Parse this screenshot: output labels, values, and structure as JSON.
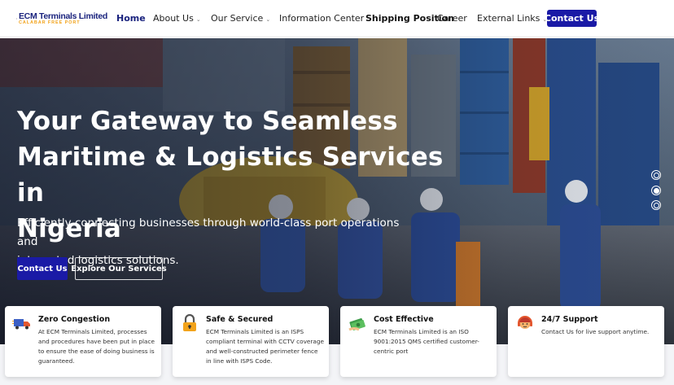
{
  "brand": {
    "name": "ECM Terminals Limited",
    "tagline": "CALABAR FREE PORT"
  },
  "nav": {
    "items": [
      {
        "label": "Home",
        "dropdown": false,
        "active": true
      },
      {
        "label": "About Us",
        "dropdown": true
      },
      {
        "label": "Our Service",
        "dropdown": true
      },
      {
        "label": "Information Center",
        "dropdown": true
      },
      {
        "label": "Shipping Position",
        "dropdown": false
      },
      {
        "label": "Career",
        "dropdown": false
      },
      {
        "label": "External Links",
        "dropdown": true
      }
    ],
    "cta_label": "Contact Us",
    "chevron_icon": "chevron-down-icon"
  },
  "hero": {
    "title_lines": [
      "Your Gateway to Seamless",
      "Maritime & Logistics Services in",
      "Nigeria"
    ],
    "subtitle_lines": [
      "Efficiently connecting businesses through world-class port operations and",
      "integrated logistics solutions."
    ],
    "primary_button": "Contact Us",
    "secondary_button": "Explore Our Services",
    "carousel": {
      "slides": 3,
      "active_index": 1
    }
  },
  "features": [
    {
      "icon": "truck-icon",
      "title": "Zero Congestion",
      "text": "At ECM Terminals Limited, processes and procedures have been put in place to ensure the ease of doing business is guaranteed."
    },
    {
      "icon": "padlock-icon",
      "title": "Safe & Secured",
      "text": "ECM Terminals Limited is an ISPS compliant terminal with CCTV coverage and well-constructed perimeter fence in line with ISPS Code."
    },
    {
      "icon": "money-icon",
      "title": "Cost Effective",
      "text": "ECM Terminals Limited is an ISO 9001:2015 QMS certified customer-centric port"
    },
    {
      "icon": "support-agent-icon",
      "title": "24/7 Support",
      "text": "Contact Us for live support anytime."
    }
  ],
  "colors": {
    "brand_navy": "#1a237e",
    "button_blue": "#1a1aa6",
    "brand_orange": "#f2a31b"
  }
}
